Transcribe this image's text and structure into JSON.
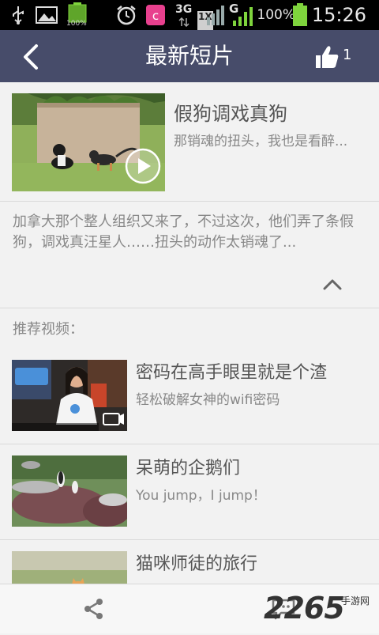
{
  "status_bar": {
    "time": "15:26",
    "battery_percent": "100%",
    "small_battery_percent": "100%",
    "network_3g": "3G",
    "network_1x": "1X",
    "network_g": "G"
  },
  "nav": {
    "title": "最新短片",
    "like_count": "1"
  },
  "feature": {
    "title": "假狗调戏真狗",
    "subtitle": "那销魂的扭头，我也是看醉...",
    "description": "加拿大那个整人组织又来了，不过这次，他们弄了条假狗，调戏真汪星人……扭头的动作太销魂了..."
  },
  "recommend": {
    "heading": "推荐视频：",
    "items": [
      {
        "title": "密码在高手眼里就是个渣",
        "subtitle": "轻松破解女神的wifi密码"
      },
      {
        "title": "呆萌的企鹅们",
        "subtitle": "You jump，I jump！"
      },
      {
        "title": "猫咪师徒的旅行",
        "subtitle": ""
      }
    ]
  },
  "watermark": {
    "text": "2265",
    "suffix": "手游网"
  },
  "colors": {
    "nav_bg": "#474c6a",
    "page_bg": "#f2f2f2",
    "signal_green": "#7fd43d"
  }
}
